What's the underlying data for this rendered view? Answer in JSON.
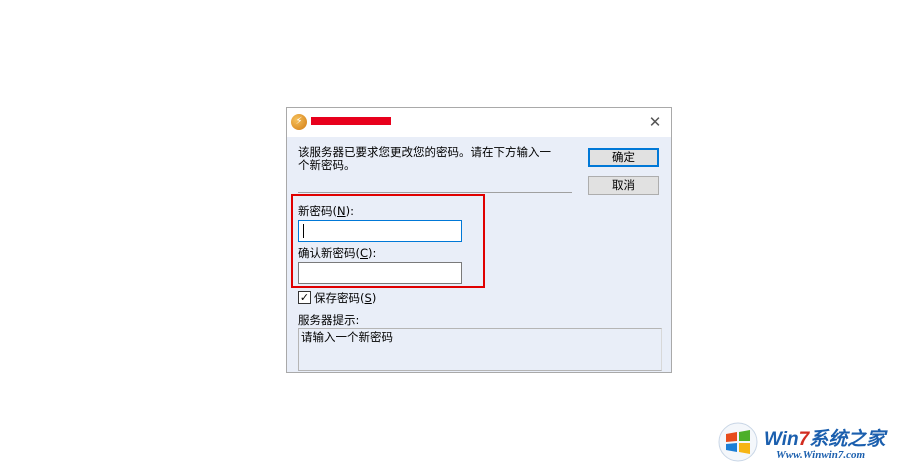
{
  "dialog": {
    "title_redacted": true,
    "message_line1": "该服务器已要求您更改您的密码。请在下方输入一",
    "message_line2": "个新密码。",
    "ok_label": "确定",
    "cancel_label": "取消",
    "new_password_label": "新密码(",
    "new_password_accel": "N",
    "new_password_label_end": "):",
    "new_password_value": "",
    "confirm_password_label": "确认新密码(",
    "confirm_password_accel": "C",
    "confirm_password_label_end": "):",
    "confirm_password_value": "",
    "save_password_label": "保存密码(",
    "save_password_accel": "S",
    "save_password_label_end": ")",
    "save_password_checked": true,
    "server_hint_label": "服务器提示:",
    "server_hint_text": "请输入一个新密码",
    "highlight_color": "#e00000",
    "title_redaction_color": "#e8001c"
  },
  "watermark": {
    "brand_prefix": "Win",
    "brand_seven": "7",
    "brand_suffix": "系统之家",
    "url": "Www.Winwin7.com"
  }
}
